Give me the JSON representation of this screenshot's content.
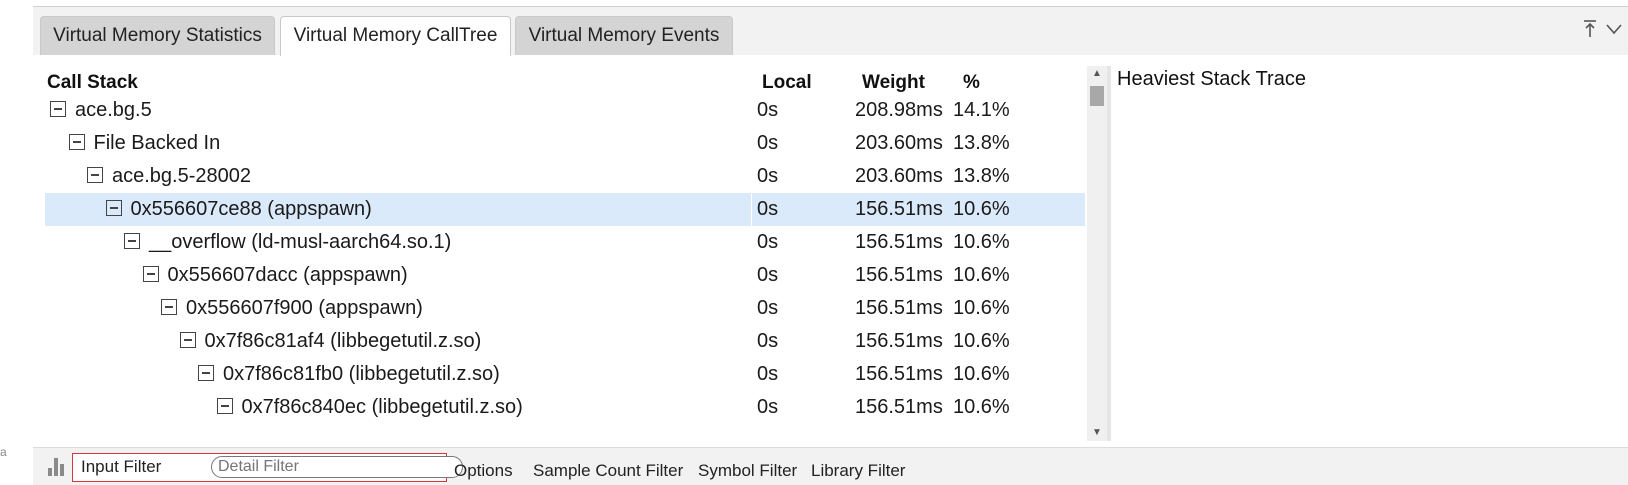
{
  "outer": {
    "left_char": "a"
  },
  "tabs": [
    {
      "label": "Virtual Memory Statistics",
      "active": false
    },
    {
      "label": "Virtual Memory CallTree",
      "active": true
    },
    {
      "label": "Virtual Memory Events",
      "active": false
    }
  ],
  "tab_icons": [
    "pin-top-icon",
    "chevron-down-icon"
  ],
  "columns": {
    "call_stack": "Call Stack",
    "local": "Local",
    "weight": "Weight",
    "percent": "%"
  },
  "rows": [
    {
      "name": "ace.bg.5",
      "local": "0s",
      "weight": "208.98ms",
      "pct": "14.1%",
      "depth": 0,
      "selected": false
    },
    {
      "name": "File Backed In",
      "local": "0s",
      "weight": "203.60ms",
      "pct": "13.8%",
      "depth": 1,
      "selected": false
    },
    {
      "name": "ace.bg.5-28002",
      "local": "0s",
      "weight": "203.60ms",
      "pct": "13.8%",
      "depth": 2,
      "selected": false
    },
    {
      "name": "0x556607ce88 (appspawn)",
      "local": "0s",
      "weight": "156.51ms",
      "pct": "10.6%",
      "depth": 3,
      "selected": true
    },
    {
      "name": "__overflow (ld-musl-aarch64.so.1)",
      "local": "0s",
      "weight": "156.51ms",
      "pct": "10.6%",
      "depth": 4,
      "selected": false
    },
    {
      "name": "0x556607dacc (appspawn)",
      "local": "0s",
      "weight": "156.51ms",
      "pct": "10.6%",
      "depth": 5,
      "selected": false
    },
    {
      "name": "0x556607f900 (appspawn)",
      "local": "0s",
      "weight": "156.51ms",
      "pct": "10.6%",
      "depth": 6,
      "selected": false
    },
    {
      "name": "0x7f86c81af4 (libbegetutil.z.so)",
      "local": "0s",
      "weight": "156.51ms",
      "pct": "10.6%",
      "depth": 7,
      "selected": false
    },
    {
      "name": "0x7f86c81fb0 (libbegetutil.z.so)",
      "local": "0s",
      "weight": "156.51ms",
      "pct": "10.6%",
      "depth": 8,
      "selected": false
    },
    {
      "name": "0x7f86c840ec (libbegetutil.z.so)",
      "local": "0s",
      "weight": "156.51ms",
      "pct": "10.6%",
      "depth": 9,
      "selected": false
    }
  ],
  "heaviest": {
    "title": "Heaviest Stack Trace"
  },
  "bottom": {
    "input_filter_label": "Input Filter",
    "detail_filter_placeholder": "Detail Filter",
    "options_label": "Options",
    "sample_count_filter_label": "Sample Count Filter",
    "symbol_filter_label": "Symbol Filter",
    "library_filter_label": "Library Filter"
  },
  "colors": {
    "selected_row": "#dbeafa",
    "filter_border": "#d9363e",
    "tab_inactive": "#d4d4d4"
  }
}
